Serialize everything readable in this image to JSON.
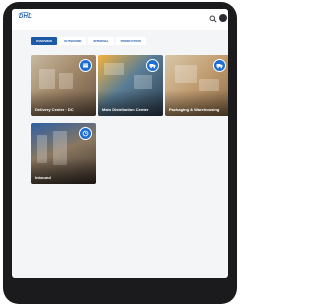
{
  "app": {
    "logo_text": "DHL"
  },
  "tabs": [
    {
      "label": "OVERVIEW",
      "active": true
    },
    {
      "label": "OUTBOUND",
      "active": false
    },
    {
      "label": "INTERNAL",
      "active": false
    },
    {
      "label": "PRODUCTION",
      "active": false
    }
  ],
  "cards": [
    {
      "label": "Delivery Center · DC",
      "badge_icon": "box-icon"
    },
    {
      "label": "Main Distribution Center",
      "badge_icon": "truck-icon"
    },
    {
      "label": "Packaging & Warehousing",
      "badge_icon": "truck-icon"
    },
    {
      "label": "Inbound",
      "badge_icon": "clock-icon"
    }
  ],
  "colors": {
    "accent": "#1f5aa6",
    "badge": "#1f6fd1",
    "frame": "#1b1b1d"
  }
}
